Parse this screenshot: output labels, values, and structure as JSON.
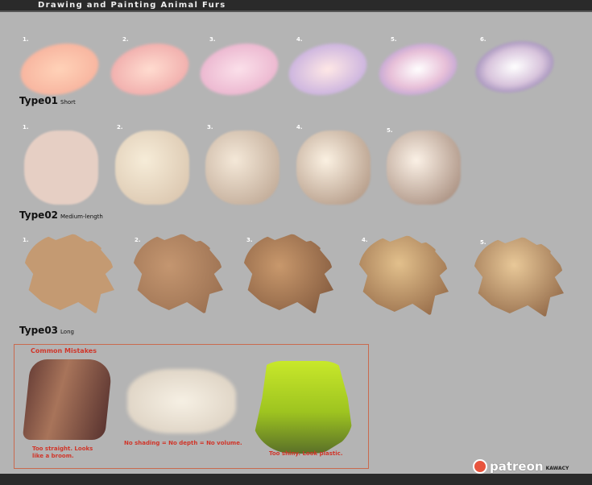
{
  "title": "Drawing and Painting Animal Furs",
  "rows": [
    {
      "type": "Type01",
      "desc": "Short",
      "steps": [
        "1.",
        "2.",
        "3.",
        "4.",
        "5.",
        "6."
      ]
    },
    {
      "type": "Type02",
      "desc": "Medium-length",
      "steps": [
        "1.",
        "2.",
        "3.",
        "4.",
        "5."
      ]
    },
    {
      "type": "Type03",
      "desc": "Long",
      "steps": [
        "1.",
        "2.",
        "3.",
        "4.",
        "5."
      ]
    }
  ],
  "mistakes": {
    "heading": "Common Mistakes",
    "items": [
      "Too straight. Looks like a broom.",
      "No shading = No depth = No volume.",
      "Too shiny. Look plastic."
    ]
  },
  "brand": {
    "name": "patreon",
    "author": "KAWACY"
  },
  "colors": {
    "accent": "#d0362a",
    "box": "#c96a4e"
  }
}
